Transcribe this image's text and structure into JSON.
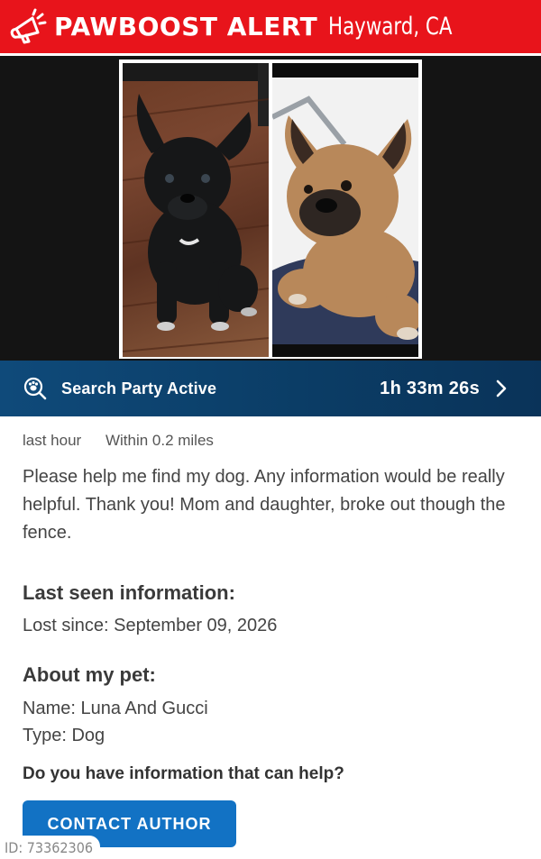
{
  "header": {
    "icon": "megaphone-icon",
    "brand": "PAWBOOST ALERT",
    "location": "Hayward, CA",
    "background_color": "#e8141b"
  },
  "photos": {
    "left": "black-french-bulldog-photo",
    "right": "fawn-french-bulldog-photo"
  },
  "search_party": {
    "icon": "search-paw-icon",
    "label": "Search Party Active",
    "timer": "1h 33m 26s",
    "chevron_icon": "chevron-right-icon",
    "background_color": "#0b3d66"
  },
  "post": {
    "time": "last hour",
    "distance": "Within 0.2 miles",
    "description": "Please help me find my dog. Any information would be really helpful. Thank you! Mom and daughter, broke out though the fence."
  },
  "last_seen": {
    "heading": "Last seen information:",
    "lost_since": "Lost since: September 09, 2026"
  },
  "about": {
    "heading": "About my pet:",
    "name": "Name: Luna And Gucci",
    "type": "Type: Dog"
  },
  "cta": {
    "question": "Do you have information that can help?",
    "button_label": "CONTACT AUTHOR",
    "button_color": "#1272c4"
  },
  "footer": {
    "id_label": "ID: 73362306"
  }
}
